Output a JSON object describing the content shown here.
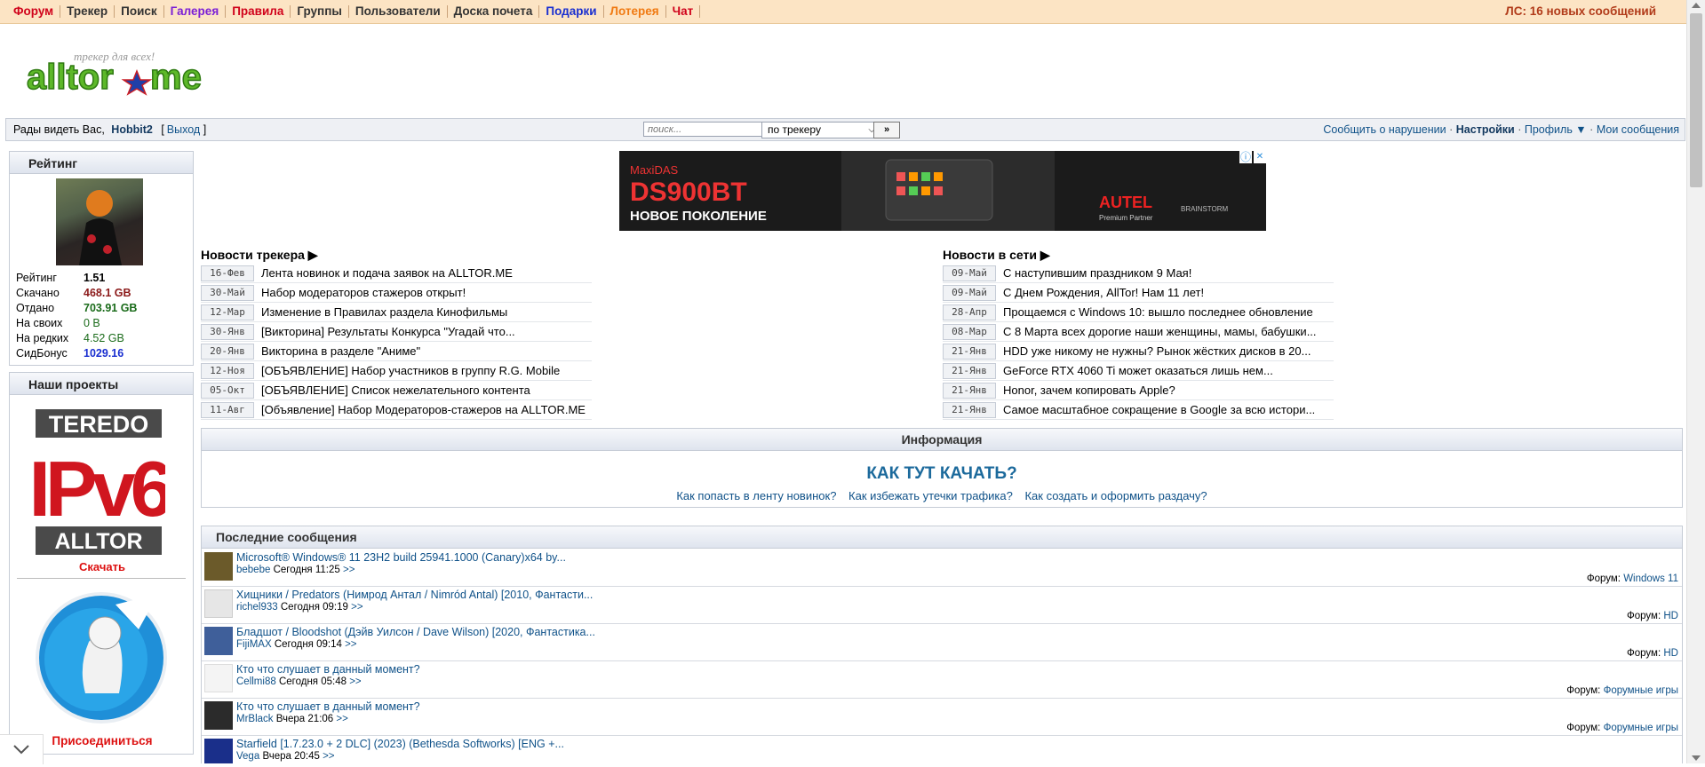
{
  "topnav": {
    "items": [
      {
        "label": "Форум",
        "color": "#d0021b"
      },
      {
        "label": "Трекер",
        "color": "#333333"
      },
      {
        "label": "Поиск",
        "color": "#333333"
      },
      {
        "label": "Галерея",
        "color": "#7b1fd6"
      },
      {
        "label": "Правила",
        "color": "#d0021b"
      },
      {
        "label": "Группы",
        "color": "#333333"
      },
      {
        "label": "Пользователи",
        "color": "#333333"
      },
      {
        "label": "Доска почета",
        "color": "#333333"
      },
      {
        "label": "Подарки",
        "color": "#1a2fd0"
      },
      {
        "label": "Лотерея",
        "color": "#f07a12"
      },
      {
        "label": "Чат",
        "color": "#d0021b"
      }
    ],
    "pm": "ЛС: 16  новых сообщений"
  },
  "logo": {
    "text_main": "alltor",
    "text_tld": "me",
    "tagline": "трекер для всех!"
  },
  "userbar": {
    "greeting": "Рады видеть Вас,",
    "username": "Hobbit2",
    "bracket_open": "[",
    "logout": "Выход",
    "bracket_close": "]",
    "search_placeholder": "поиск...",
    "search_scope": "по трекеру",
    "search_go": "»",
    "links": [
      "Сообщить о нарушении",
      "Настройки",
      "Профиль ▼",
      "Мои сообщения"
    ],
    "sep": "·"
  },
  "sidebar": {
    "rating_title": "Рейтинг",
    "stats": [
      {
        "label": "Рейтинг",
        "value": "1.51",
        "color": "#000000"
      },
      {
        "label": "Скачано",
        "value": "468.1 GB",
        "color": "#8b1a1a"
      },
      {
        "label": "Отдано",
        "value": "703.91 GB",
        "color": "#1a6b1a"
      },
      {
        "label": "На своих",
        "value": "0 B",
        "color": "#1a6b1a"
      },
      {
        "label": "На редких",
        "value": "4.52 GB",
        "color": "#1a6b1a"
      },
      {
        "label": "СидБонус",
        "value": "1029.16",
        "color": "#1a2fd0"
      }
    ],
    "projects_title": "Наши проекты",
    "teredo": {
      "top": "TEREDO",
      "mid": "IPv6",
      "bottom": "ALLTOR"
    },
    "download": "Скачать",
    "join": "Присоединиться"
  },
  "ad": {
    "brand": "MaxiDAS",
    "model": "DS900BT",
    "tagline": "НОВОЕ ПОКОЛЕНИЕ",
    "maker": "AUTEL",
    "partner": "Premium Partner",
    "partner2": "BRAINSTORM",
    "info_icon": "ⓘ",
    "close_icon": "✕"
  },
  "tracker_news": {
    "title": "Новости трекера ▶",
    "items": [
      {
        "date": "16-Фев",
        "title": "Лента новинок и подача заявок на ALLTOR.ME"
      },
      {
        "date": "30-Май",
        "title": "Набор модераторов стажеров открыт!"
      },
      {
        "date": "12-Мар",
        "title": "Изменение в Правилах раздела Кинофильмы"
      },
      {
        "date": "30-Янв",
        "title": "[Викторина] Результаты Конкурса \"Угадай что..."
      },
      {
        "date": "20-Янв",
        "title": "Викторина в разделе \"Аниме\""
      },
      {
        "date": "12-Ноя",
        "title": "[ОБЪЯВЛЕНИЕ] Набор участников в группу R.G. Mobile"
      },
      {
        "date": "05-Окт",
        "title": "[ОБЪЯВЛЕНИЕ] Список нежелательного контента"
      },
      {
        "date": "11-Авг",
        "title": "[Объявление] Набор Модераторов-стажеров на ALLTOR.ME"
      }
    ]
  },
  "web_news": {
    "title": "Новости в сети ▶",
    "items": [
      {
        "date": "09-Май",
        "title": "С наступившим праздником 9 Мая!"
      },
      {
        "date": "09-Май",
        "title": "С Днем Рождения, AllTor! Нам 11 лет!"
      },
      {
        "date": "28-Апр",
        "title": "Прощаемся с Windows 10: вышло последнее обновление"
      },
      {
        "date": "08-Мар",
        "title": "С 8 Марта всех дорогие наши женщины, мамы, бабушки..."
      },
      {
        "date": "21-Янв",
        "title": "HDD уже никому не нужны? Рынок жёстких дисков в 20..."
      },
      {
        "date": "21-Янв",
        "title": "GeForce RTX 4060 Ti может оказаться лишь нем..."
      },
      {
        "date": "21-Янв",
        "title": "Honor, зачем копировать Apple?"
      },
      {
        "date": "21-Янв",
        "title": "Самое масштабное сокращение в Google за всю истори..."
      }
    ]
  },
  "info": {
    "title": "Информация",
    "big_link": "КАК ТУТ КАЧАТЬ?",
    "links": [
      "Как попасть в ленту новинок?",
      "Как избежать утечки трафика?",
      "Как создать и оформить раздачу?"
    ]
  },
  "latest": {
    "title": "Последние сообщения",
    "forum_label": "Форум:",
    "more": ">>",
    "items": [
      {
        "title": "Microsoft® Windows® 11 23H2 build 25941.1000 (Canary)x64 by...",
        "author": "bebebe",
        "time": "Сегодня 11:25",
        "forum": "Windows 11",
        "ava": "#6b5a2a"
      },
      {
        "title": "Хищники / Predators (Нимрод Антал / Nimród Antal) [2010, Фантасти...",
        "author": "richel933",
        "time": "Сегодня 09:19",
        "forum": "HD",
        "ava": "#e6e6e6"
      },
      {
        "title": "Бладшот / Bloodshot (Дэйв Уилсон / Dave Wilson) [2020, Фантастика...",
        "author": "FijiMAX",
        "time": "Сегодня 09:14",
        "forum": "HD",
        "ava": "#3f5f9a"
      },
      {
        "title": "Кто что слушает в данный момент?",
        "author": "Cellmi88",
        "time": "Сегодня 05:48",
        "forum": "Форумные игры",
        "ava": "#f4f4f4"
      },
      {
        "title": "Кто что слушает в данный момент?",
        "author": "MrBlack",
        "time": "Вчера 21:06",
        "forum": "Форумные игры",
        "ava": "#2b2b2b"
      },
      {
        "title": "Starfield [1.7.23.0 + 2 DLC] (2023) (Bethesda Softworks) [ENG +...",
        "author": "Vega",
        "time": "Вчера 20:45",
        "forum": "",
        "ava": "#1a2f8a"
      }
    ]
  },
  "colors": {
    "topbar": "#fce4c4",
    "link": "#105289",
    "panel_border": "#c6ccd6"
  }
}
